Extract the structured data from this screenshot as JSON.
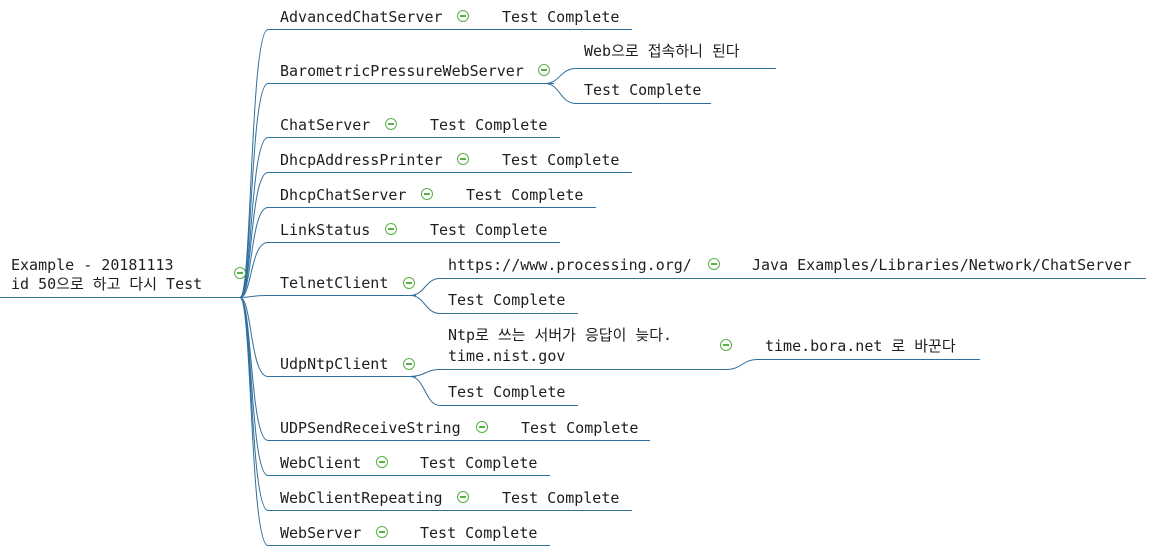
{
  "root": {
    "line1": "Example - 20181113",
    "line2": "id 50으로 하고 다시 Test"
  },
  "branches": [
    {
      "name": "AdvancedChatServer",
      "children": [
        "Test Complete"
      ]
    },
    {
      "name": "BarometricPressureWebServer",
      "children": [
        "Web으로 접속하니 된다",
        "Test Complete"
      ]
    },
    {
      "name": "ChatServer",
      "children": [
        "Test Complete"
      ]
    },
    {
      "name": "DhcpAddressPrinter",
      "children": [
        "Test Complete"
      ]
    },
    {
      "name": "DhcpChatServer",
      "children": [
        "Test Complete"
      ]
    },
    {
      "name": "LinkStatus",
      "children": [
        "Test Complete"
      ]
    },
    {
      "name": "TelnetClient",
      "children": [
        "https://www.processing.org/",
        "Java Examples/Libraries/Network/ChatServer",
        "Test Complete"
      ]
    },
    {
      "name": "UdpNtpClient",
      "children": [
        "Ntp로 쓰는 서버가 응답이 늦다.",
        "time.nist.gov",
        "time.bora.net 로 바꾼다",
        "Test Complete"
      ]
    },
    {
      "name": "UDPSendReceiveString",
      "children": [
        "Test Complete"
      ]
    },
    {
      "name": "WebClient",
      "children": [
        "Test Complete"
      ]
    },
    {
      "name": "WebClientRepeating",
      "children": [
        "Test Complete"
      ]
    },
    {
      "name": "WebServer",
      "children": [
        "Test Complete"
      ]
    }
  ],
  "colors": {
    "line": "#2e6f9e",
    "collapse_icon": "#59b047",
    "text": "#1e1e1e"
  },
  "icons": {
    "collapse": "collapse-minus-icon"
  }
}
